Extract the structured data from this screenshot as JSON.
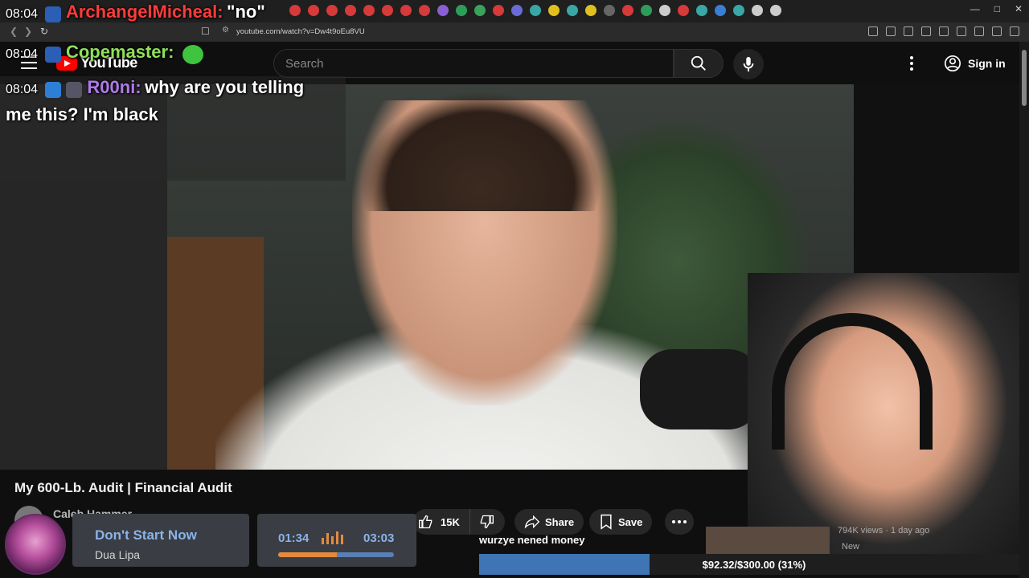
{
  "browser": {
    "url": "youtube.com/watch?v=Dw4t9oEu8VU",
    "tab_colors": [
      "#d63a3a",
      "#d63a3a",
      "#d63a3a",
      "#d63a3a",
      "#d63a3a",
      "#d63a3a",
      "#d63a3a",
      "#d63a3a",
      "#8a5fd6",
      "#2d9e5a",
      "#3aa35a",
      "#d63a3a",
      "#6b6bd6",
      "#3aa7a7",
      "#e0c020",
      "#3aa7a7",
      "#e0c020",
      "#666666",
      "#d63a3a",
      "#2d9e5a",
      "#cccccc",
      "#d63a3a",
      "#3aa7a7",
      "#3a7fd6",
      "#3aa7a7",
      "#cccccc",
      "#cccccc"
    ]
  },
  "youtube": {
    "logo_text": "YouTube",
    "search_placeholder": "Search",
    "signin_label": "Sign in"
  },
  "chat": [
    {
      "time": "08:04",
      "user": "ArchangelMicheal:",
      "message": "\"no\"",
      "user_color": "#ff3b3b"
    },
    {
      "time": "08:04",
      "user": "Copemaster:",
      "message": "",
      "user_color": "#8ee05a"
    },
    {
      "time": "08:04",
      "user": "R00ni:",
      "message": "why are you telling",
      "user_color": "#b07ae8"
    },
    {
      "continuation": "me this? I'm black"
    }
  ],
  "video": {
    "title": "My 600-Lb. Audit | Financial Audit",
    "channel": "Caleb Hammer",
    "likes": "15K",
    "share_label": "Share",
    "save_label": "Save"
  },
  "related": {
    "views": "794K views · 1 day ago",
    "badge": "New"
  },
  "now_playing": {
    "title": "Don't Start Now",
    "artist": "Dua Lipa",
    "elapsed": "01:34",
    "total": "03:03",
    "progress": 0.51
  },
  "goal": {
    "label": "wurzye nened money",
    "text": "$92.32/$300.00 (31%)",
    "fraction": 0.31
  }
}
